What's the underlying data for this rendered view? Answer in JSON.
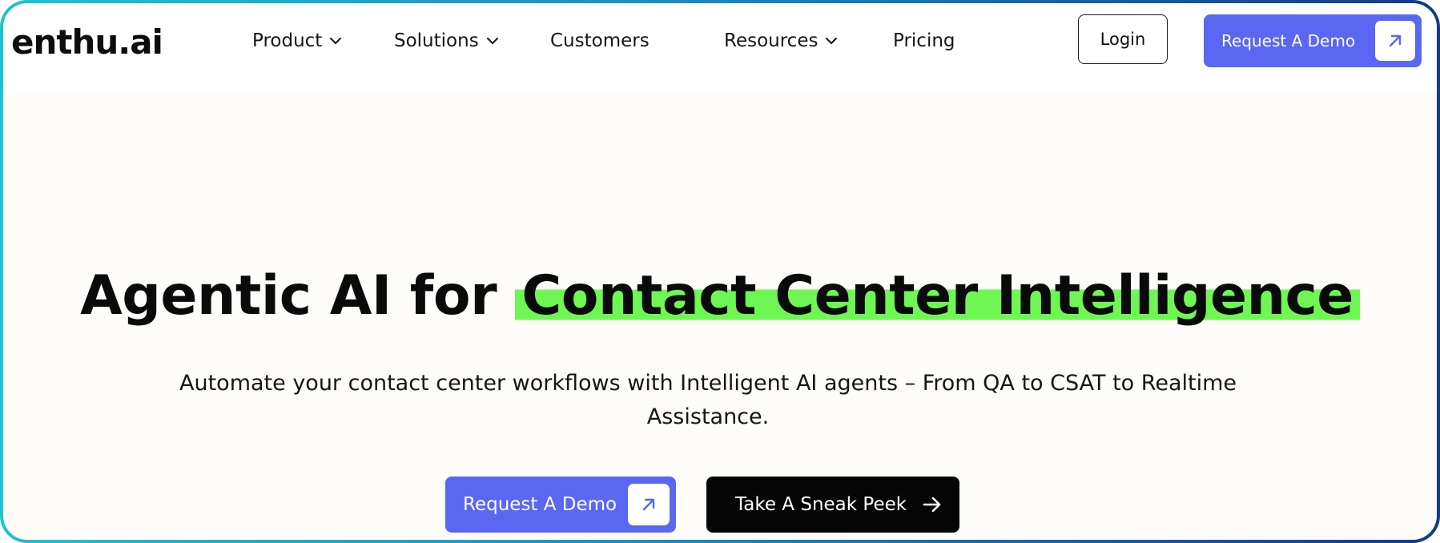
{
  "brand": {
    "logo_text": "enthu.ai"
  },
  "nav": {
    "items": [
      {
        "label": "Product",
        "has_dropdown": true
      },
      {
        "label": "Solutions",
        "has_dropdown": true
      },
      {
        "label": "Customers",
        "has_dropdown": false
      },
      {
        "label": "Resources",
        "has_dropdown": true
      },
      {
        "label": "Pricing",
        "has_dropdown": false
      }
    ],
    "login_label": "Login",
    "demo_label": "Request A Demo"
  },
  "hero": {
    "headline_prefix": "Agentic AI for ",
    "headline_highlight": "Contact Center Intelligence",
    "subtitle": "Automate your contact center workflows with Intelligent AI agents – From QA to CSAT to Realtime Assistance.",
    "primary_cta": "Request A Demo",
    "secondary_cta": "Take A Sneak Peek"
  },
  "colors": {
    "accent": "#5a67f2",
    "highlight": "#6ef753",
    "dark_button": "#050505",
    "hero_background": "#fdfcf8",
    "frame_gradient": [
      "#1ec3cf",
      "#123a8a"
    ]
  },
  "icons": {
    "dropdown": "chevron-down-icon",
    "demo_arrow": "arrow-up-right-icon",
    "peek_arrow": "arrow-right-icon"
  }
}
